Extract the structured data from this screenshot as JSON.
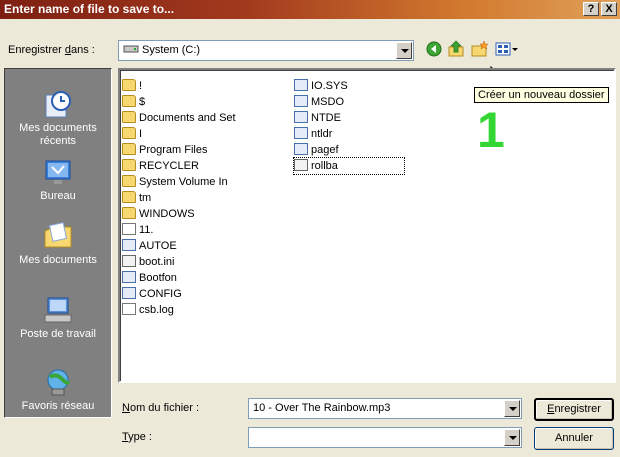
{
  "window": {
    "title": "Enter name of file to save to...",
    "help_btn": "?",
    "close_btn": "X"
  },
  "save_in": {
    "label_pre": "Enregistrer ",
    "label_accel": "d",
    "label_post": "ans :",
    "value": "System (C:)"
  },
  "tooltip": "Créer un nouveau dossier",
  "annotation": "1",
  "places": [
    {
      "label": "Mes documents récents",
      "icon": "recent-documents-icon"
    },
    {
      "label": "Bureau",
      "icon": "desktop-icon"
    },
    {
      "label": "Mes documents",
      "icon": "my-documents-icon"
    },
    {
      "label": "Poste de travail",
      "icon": "my-computer-icon"
    },
    {
      "label": "Favoris réseau",
      "icon": "network-places-icon"
    }
  ],
  "files_col1": [
    {
      "name": "!",
      "type": "folder"
    },
    {
      "name": "$",
      "type": "folder"
    },
    {
      "name": "Documents and Set",
      "type": "folder"
    },
    {
      "name": "I",
      "type": "folder"
    },
    {
      "name": "Program Files",
      "type": "folder"
    },
    {
      "name": "RECYCLER",
      "type": "folder"
    },
    {
      "name": "System Volume In",
      "type": "folder"
    },
    {
      "name": "tm",
      "type": "folder"
    },
    {
      "name": "WINDOWS",
      "type": "folder"
    },
    {
      "name": "11.",
      "type": "text"
    },
    {
      "name": "AUTOE",
      "type": "system"
    },
    {
      "name": "boot.ini",
      "type": "settings"
    },
    {
      "name": "Bootfon",
      "type": "system"
    },
    {
      "name": "CONFIG",
      "type": "system"
    },
    {
      "name": "csb.log",
      "type": "text"
    }
  ],
  "files_col2": [
    {
      "name": "IO.SYS",
      "type": "system"
    },
    {
      "name": "MSDO",
      "type": "system"
    },
    {
      "name": "NTDE",
      "type": "system"
    },
    {
      "name": "ntldr",
      "type": "system"
    },
    {
      "name": "pagef",
      "type": "system"
    },
    {
      "name": "rollba",
      "type": "settings"
    }
  ],
  "filename": {
    "label_accel": "N",
    "label_post": "om du fichier :",
    "value": "10 - Over The Rainbow.mp3"
  },
  "filetype": {
    "label_accel": "T",
    "label_post": "ype :",
    "value": ""
  },
  "buttons": {
    "save_accel": "E",
    "save_post": "nregistrer",
    "cancel": "Annuler"
  }
}
